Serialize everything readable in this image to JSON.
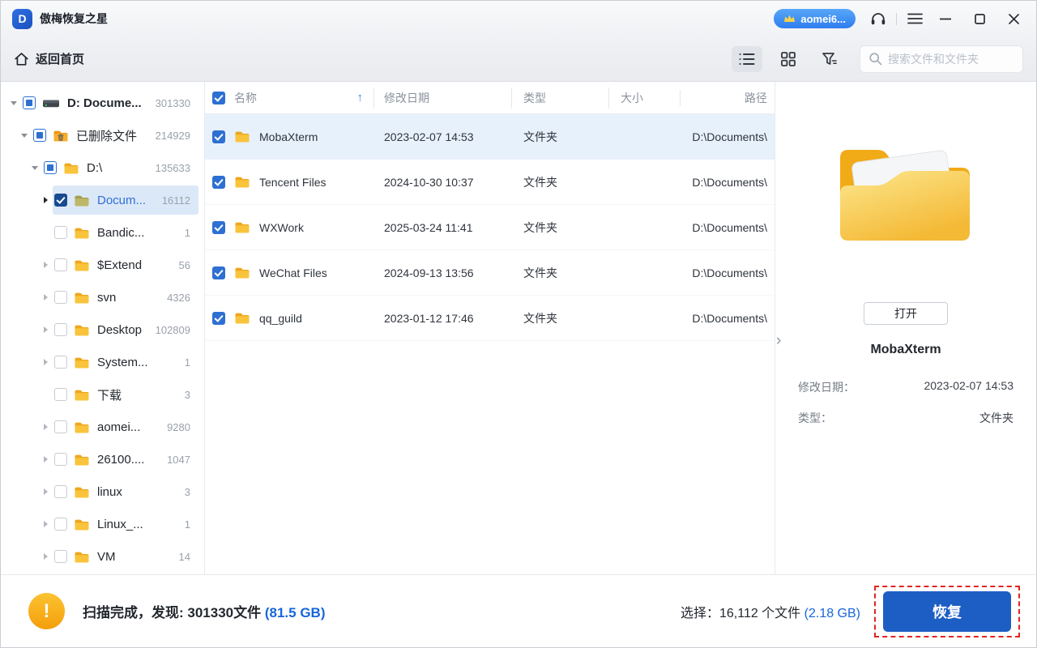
{
  "window": {
    "title": "傲梅恢复之星",
    "logo_letter": "D",
    "account_badge": "aomei6..."
  },
  "toolbar": {
    "back_home": "返回首页",
    "search_placeholder": "搜索文件和文件夹"
  },
  "sidebar": {
    "items": [
      {
        "label": "D: Docume...",
        "count": "301330",
        "level": 0,
        "arrow": "expanded",
        "checkbox": "partial",
        "icon": "drive",
        "selected": false
      },
      {
        "label": "已删除文件",
        "count": "214929",
        "level": 1,
        "arrow": "expanded",
        "checkbox": "partial",
        "icon": "folder-trash",
        "selected": false
      },
      {
        "label": "D:\\",
        "count": "135633",
        "level": 2,
        "arrow": "expanded",
        "checkbox": "partial",
        "icon": "folder",
        "selected": false
      },
      {
        "label": "Docum...",
        "count": "16112",
        "level": 3,
        "arrow": "collapsed-active",
        "checkbox": "checked",
        "icon": "folder-selected",
        "selected": true
      },
      {
        "label": "Bandic...",
        "count": "1",
        "level": 3,
        "arrow": "none",
        "checkbox": "unchecked",
        "icon": "folder",
        "selected": false
      },
      {
        "label": "$Extend",
        "count": "56",
        "level": 3,
        "arrow": "collapsed",
        "checkbox": "unchecked",
        "icon": "folder",
        "selected": false
      },
      {
        "label": "svn",
        "count": "4326",
        "level": 3,
        "arrow": "collapsed",
        "checkbox": "unchecked",
        "icon": "folder",
        "selected": false
      },
      {
        "label": "Desktop",
        "count": "102809",
        "level": 3,
        "arrow": "collapsed",
        "checkbox": "unchecked",
        "icon": "folder",
        "selected": false
      },
      {
        "label": "System...",
        "count": "1",
        "level": 3,
        "arrow": "collapsed",
        "checkbox": "unchecked",
        "icon": "folder",
        "selected": false
      },
      {
        "label": "下载",
        "count": "3",
        "level": 3,
        "arrow": "none",
        "checkbox": "unchecked",
        "icon": "folder",
        "selected": false
      },
      {
        "label": "aomei...",
        "count": "9280",
        "level": 3,
        "arrow": "collapsed",
        "checkbox": "unchecked",
        "icon": "folder",
        "selected": false
      },
      {
        "label": "26100....",
        "count": "1047",
        "level": 3,
        "arrow": "collapsed",
        "checkbox": "unchecked",
        "icon": "folder",
        "selected": false
      },
      {
        "label": "linux",
        "count": "3",
        "level": 3,
        "arrow": "collapsed",
        "checkbox": "unchecked",
        "icon": "folder",
        "selected": false
      },
      {
        "label": "Linux_...",
        "count": "1",
        "level": 3,
        "arrow": "collapsed",
        "checkbox": "unchecked",
        "icon": "folder",
        "selected": false
      },
      {
        "label": "VM",
        "count": "14",
        "level": 3,
        "arrow": "collapsed",
        "checkbox": "unchecked",
        "icon": "folder",
        "selected": false
      }
    ]
  },
  "table": {
    "columns": {
      "name": "名称",
      "date": "修改日期",
      "type": "类型",
      "size": "大小",
      "path": "路径"
    },
    "sort_indicator": "↑",
    "rows": [
      {
        "name": "MobaXterm",
        "modified": "2023-02-07 14:53",
        "type": "文件夹",
        "size": "",
        "path": "D:\\Documents\\",
        "checked": true,
        "selected": true
      },
      {
        "name": "Tencent Files",
        "modified": "2024-10-30 10:37",
        "type": "文件夹",
        "size": "",
        "path": "D:\\Documents\\",
        "checked": true,
        "selected": false
      },
      {
        "name": "WXWork",
        "modified": "2025-03-24 11:41",
        "type": "文件夹",
        "size": "",
        "path": "D:\\Documents\\",
        "checked": true,
        "selected": false
      },
      {
        "name": "WeChat Files",
        "modified": "2024-09-13 13:56",
        "type": "文件夹",
        "size": "",
        "path": "D:\\Documents\\",
        "checked": true,
        "selected": false
      },
      {
        "name": "qq_guild",
        "modified": "2023-01-12 17:46",
        "type": "文件夹",
        "size": "",
        "path": "D:\\Documents\\",
        "checked": true,
        "selected": false
      }
    ]
  },
  "preview": {
    "open_button": "打开",
    "file_name": "MobaXterm",
    "fields": [
      {
        "label": "修改日期：",
        "value": "2023-02-07 14:53"
      },
      {
        "label": "类型：",
        "value": "文件夹"
      }
    ]
  },
  "footer": {
    "scan_label": "扫描完成，发现: 301330文件",
    "scan_size": "(81.5 GB)",
    "select_label": "选择：16,112 个文件",
    "select_size": "(2.18 GB)",
    "recover_button": "恢复"
  },
  "colors": {
    "accent_blue": "#2e6fd2",
    "button_blue": "#1d5ec4",
    "warning_orange": "#f5a623",
    "highlight_red_dashed": "#e02620"
  }
}
